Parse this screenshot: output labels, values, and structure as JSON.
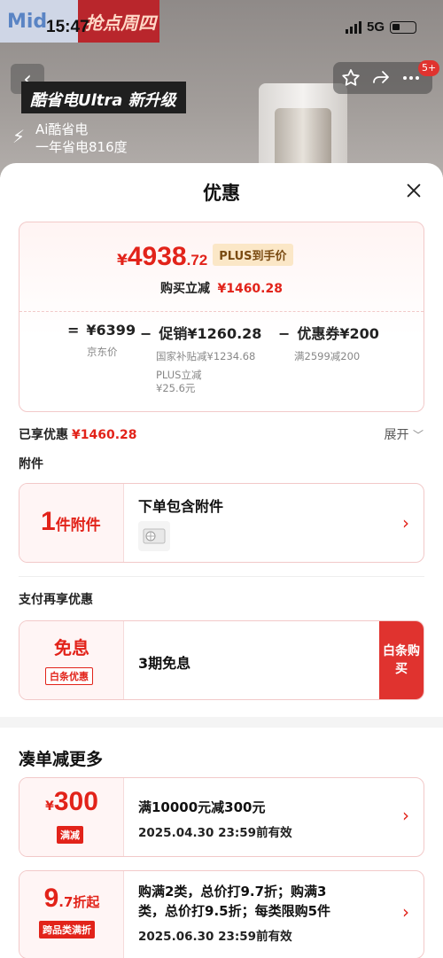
{
  "status_bar": {
    "time": "15:47",
    "network": "5G"
  },
  "background": {
    "brand_left": "Mid",
    "brand_right": "抢点周四",
    "promo_title": "酷省电Ultra 新升级",
    "promo_line1": "Ai酷省电",
    "promo_line2": "一年省电816度",
    "cart_badge": "5+"
  },
  "sheet": {
    "title": "优惠",
    "price": {
      "yen": "¥",
      "integer": "4938",
      "decimal": ".72",
      "plus_tag": "PLUS到手价",
      "save_label": "购买立减",
      "save_value": "¥1460.28"
    },
    "breakdown": [
      {
        "op": "=",
        "value": "¥6399",
        "sub": [
          "京东价"
        ]
      },
      {
        "op": "−",
        "value": "促销¥1260.28",
        "sub": [
          "国家补贴减¥1234.68",
          "PLUS立减",
          "¥25.6元"
        ]
      },
      {
        "op": "−",
        "value": "优惠券¥200",
        "sub": [
          "满2599减200"
        ]
      }
    ],
    "enjoyed_label": "已享优惠",
    "enjoyed_value": "¥1460.28",
    "expand_label": "展开",
    "accessories_label": "附件",
    "accessory": {
      "count": "1",
      "unit": "件附件",
      "title": "下单包含附件"
    },
    "pay_label": "支付再享优惠",
    "pay": {
      "big": "免息",
      "tag": "白条优惠",
      "title": "3期免息",
      "button": "白条购买"
    },
    "more_title": "凑单减更多",
    "offers": [
      {
        "amount_prefix": "¥",
        "amount": "300",
        "amount_suffix": "",
        "tag": "满减",
        "lines": [
          "满10000元减300元"
        ],
        "date": "2025.04.30 23:59前有效"
      },
      {
        "amount_prefix": "",
        "amount": "9",
        "amount_suffix": ".7折起",
        "tag": "跨品类满折",
        "lines": [
          "购满2类，总价打9.7折；购满3",
          "类，总价打9.5折；每类限购5件"
        ],
        "date": "2025.06.30 23:59前有效"
      }
    ]
  },
  "colors": {
    "accent": "#e2231a",
    "plus_bg": "#fbe7c7",
    "card_border": "#f2c9c9"
  }
}
